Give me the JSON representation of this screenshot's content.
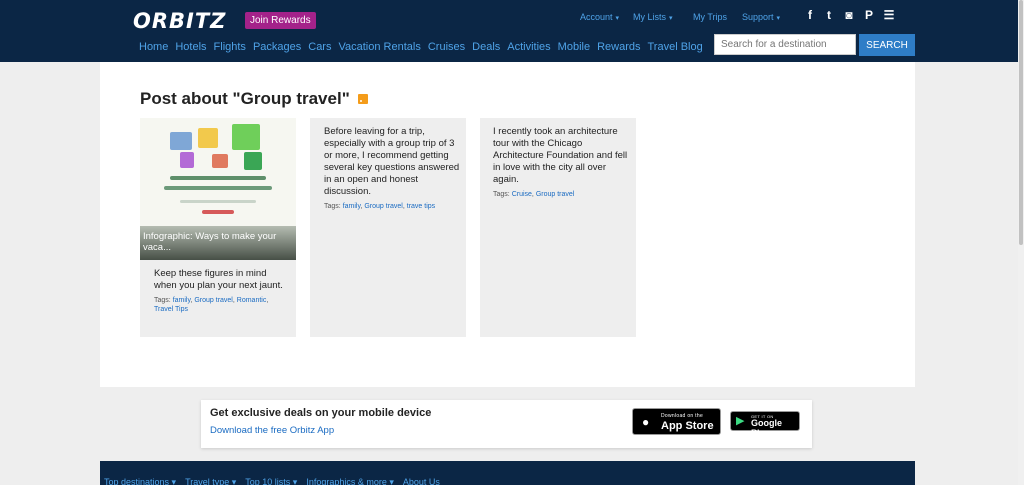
{
  "header": {
    "logo": "ORBITZ",
    "join_rewards": "Join Rewards",
    "util_links": [
      {
        "label": "Account",
        "caret": "▾"
      },
      {
        "label": "My Lists",
        "caret": "▾"
      },
      {
        "label": "My Trips",
        "caret": ""
      },
      {
        "label": "Support",
        "caret": "▾"
      }
    ],
    "social": [
      {
        "name": "facebook-icon",
        "glyph": "f"
      },
      {
        "name": "twitter-icon",
        "glyph": "t"
      },
      {
        "name": "instagram-icon",
        "glyph": "◙"
      },
      {
        "name": "pinterest-icon",
        "glyph": "P"
      },
      {
        "name": "rss-feed-icon",
        "glyph": "☰"
      }
    ],
    "nav": [
      "Home",
      "Hotels",
      "Flights",
      "Packages",
      "Cars",
      "Vacation Rentals",
      "Cruises",
      "Deals",
      "Activities",
      "Mobile",
      "Rewards",
      "Travel Blog"
    ],
    "search_placeholder": "Search for a destination",
    "search_button": "SEARCH"
  },
  "main": {
    "title": "Post about \"Group travel\"",
    "cards": [
      {
        "image_caption": "Infographic: Ways to make your vaca...",
        "text": "Keep these figures in mind when you plan your next jaunt.",
        "tags_label": "Tags:",
        "tags": [
          "family",
          "Group travel",
          "Romantic",
          "Travel Tips"
        ]
      },
      {
        "text": "Before leaving for a trip, especially with a group trip of 3 or more, I recommend getting several key questions answered in an open and honest discussion.",
        "tags_label": "Tags:",
        "tags": [
          "family",
          "Group travel",
          "trave tips"
        ]
      },
      {
        "text": "I recently took an architecture tour with the Chicago Architecture Foundation and fell in love with the city all over again.",
        "tags_label": "Tags:",
        "tags": [
          "Cruise",
          "Group travel"
        ]
      }
    ]
  },
  "app_banner": {
    "heading": "Get exclusive deals on your mobile device",
    "link": "Download the free Orbitz App",
    "app_store_small": "Download on the",
    "app_store_big": "App Store",
    "google_play_small": "GET IT ON",
    "google_play_big": "Google Play"
  },
  "footer": {
    "links": [
      "Top destinations ▾",
      "Travel type ▾",
      "Top 10 lists ▾",
      "Infographics & more ▾",
      "About Us"
    ]
  },
  "colors": {
    "header_bg": "#0b2645",
    "link_blue": "#4fa3e8",
    "tag_blue": "#1a6bc2",
    "rewards_purple": "#a4228a",
    "search_button": "#2e7dc7",
    "rss_orange": "#f49c1a"
  }
}
